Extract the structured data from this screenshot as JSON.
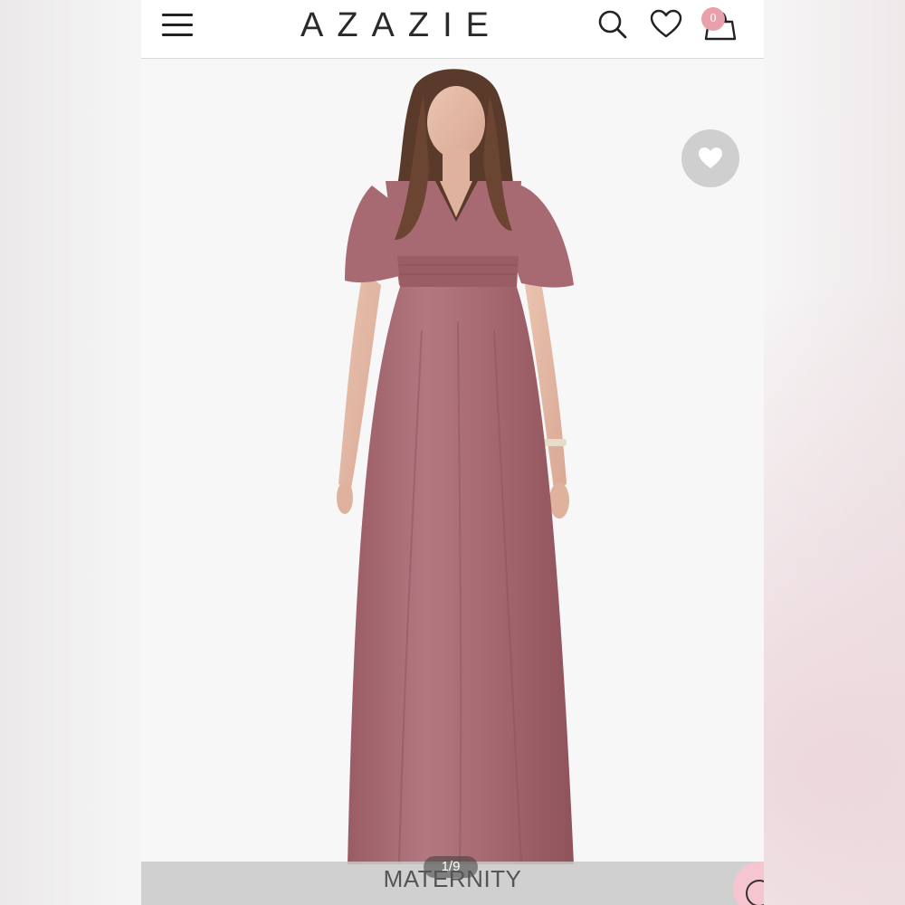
{
  "header": {
    "brand": "AZAZIE",
    "cart_count": "0"
  },
  "icons": {
    "menu": "hamburger-menu-icon",
    "search": "search-icon",
    "wishlist": "heart-outline-icon",
    "cart": "shopping-bag-icon",
    "favorite": "heart-filled-icon",
    "chat": "chat-bubble-icon"
  },
  "product": {
    "image_description_color": "#a86a72",
    "gallery_position": "1/9",
    "category_label": "MATERNITY"
  },
  "colors": {
    "badge": "#e8a0ab",
    "dress": "#a86a72",
    "chat_button": "#f5c6d0"
  }
}
